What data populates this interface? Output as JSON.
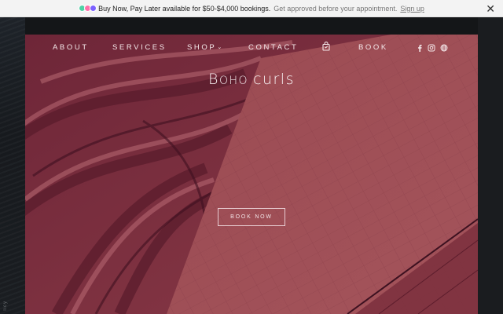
{
  "promo": {
    "logos": [
      "afterpay-logo",
      "klarna-logo",
      "affirm-logo"
    ],
    "logo_colors": [
      "#4fd1a5",
      "#ff6fa8",
      "#7b61ff"
    ],
    "main_text": "Buy Now, Pay Later available for $50-$4,000 bookings.",
    "sub_text": "Get approved before your appointment.",
    "link_text": "Sign up",
    "close_glyph": "✕"
  },
  "nav": {
    "items": [
      {
        "label": "ABOUT"
      },
      {
        "label": "SERVICES"
      },
      {
        "label": "SHOP",
        "chevron": "⌄"
      },
      {
        "label": "CONTACT"
      },
      {
        "label": "BOOK"
      }
    ],
    "icons": [
      "shopping-bag-icon",
      "facebook-icon",
      "instagram-icon",
      "globe-icon"
    ]
  },
  "hero": {
    "title_first_letter": "B",
    "title_rest_1": "OHO ",
    "title_rest_2": "curls",
    "button_label": "BOOK NOW",
    "overlay_color": "#7a2e3e"
  },
  "side": {
    "vertical_text": "licy"
  }
}
